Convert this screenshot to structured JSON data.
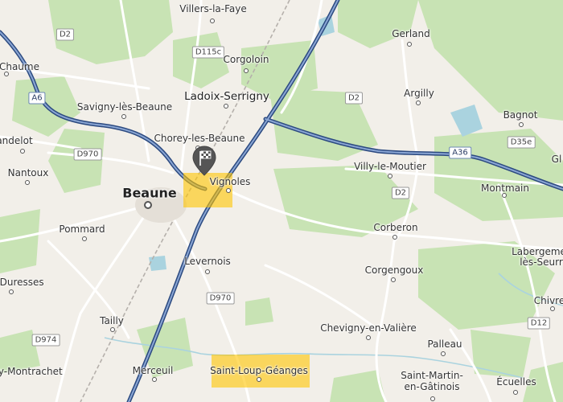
{
  "map": {
    "colors": {
      "land": "#f2efe9",
      "forest": "#c8e3b4",
      "water": "#aad3df",
      "motorway": "#4c6a9c",
      "road": "#ffffff",
      "highlight": "#ffc400"
    },
    "places": {
      "villers_la_faye": "Villers-la-Faye",
      "gerland": "Gerland",
      "corgoloin": "Corgoloin",
      "chaume": "n-Chaume",
      "savigny": "Savigny-lès-Beaune",
      "ladoix": "Ladoix-Serrigny",
      "argilly": "Argilly",
      "bagnot": "Bagnot",
      "andelot": "andelot",
      "chorey": "Chorey-les-Beaune",
      "nantoux": "Nantoux",
      "beaune": "Beaune",
      "vignoles": "Vignoles",
      "villy": "Villy-le-Moutier",
      "montmain": "Montmain",
      "pommard": "Pommard",
      "corberon": "Corberon",
      "labergement": "Labergeme",
      "labergement2": "lès-Seurr",
      "levernois": "Levernois",
      "corgengoux": "Corgengoux",
      "duresses": "-Duresses",
      "chivre": "Chivre",
      "tailly": "Tailly",
      "chevigny": "Chevigny-en-Valière",
      "palleau": "Palleau",
      "montrachet": "ny-Montrachet",
      "merceuil": "Merceuil",
      "saint_loup": "Saint-Loup-Géanges",
      "saint_martin": "Saint-Martin-",
      "saint_martin2": "en-Gâtinois",
      "ecuelles": "Écuelles",
      "gl": "Gl"
    },
    "roads": {
      "d2_nw": "D2",
      "d115c": "D115c",
      "a6": "A6",
      "d2_center": "D2",
      "a36": "A36",
      "d35e": "D35e",
      "d970_w": "D970",
      "d2_south": "D2",
      "d970_s": "D970",
      "d974": "D974",
      "d12": "D12"
    },
    "marker_icon": "checkered-flag-icon"
  }
}
